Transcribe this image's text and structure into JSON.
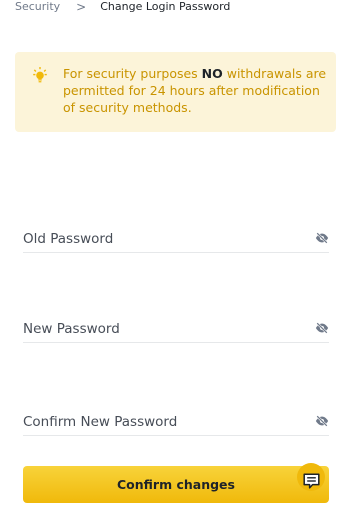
{
  "breadcrumb": {
    "parent": "Security",
    "separator": ">",
    "current": "Change Login Password"
  },
  "notice": {
    "icon": "lightbulb-icon",
    "text_before": "For security purposes ",
    "text_bold": "NO",
    "text_after": " withdrawals are permitted for 24 hours after modification of security methods."
  },
  "form": {
    "old_password": {
      "placeholder": "Old Password",
      "value": ""
    },
    "new_password": {
      "placeholder": "New Password",
      "value": ""
    },
    "confirm_password": {
      "placeholder": "Confirm New Password",
      "value": ""
    },
    "toggle_icon": "eye-slash-icon"
  },
  "confirm_button": {
    "label": "Confirm changes"
  },
  "chat_button": {
    "icon": "chat-icon"
  },
  "colors": {
    "accent": "#F0B90B",
    "notice_bg": "#FCF4D9",
    "notice_text": "#C99400",
    "text_primary": "#1E2329",
    "text_secondary": "#707A8A",
    "divider": "#E6E8EA"
  }
}
